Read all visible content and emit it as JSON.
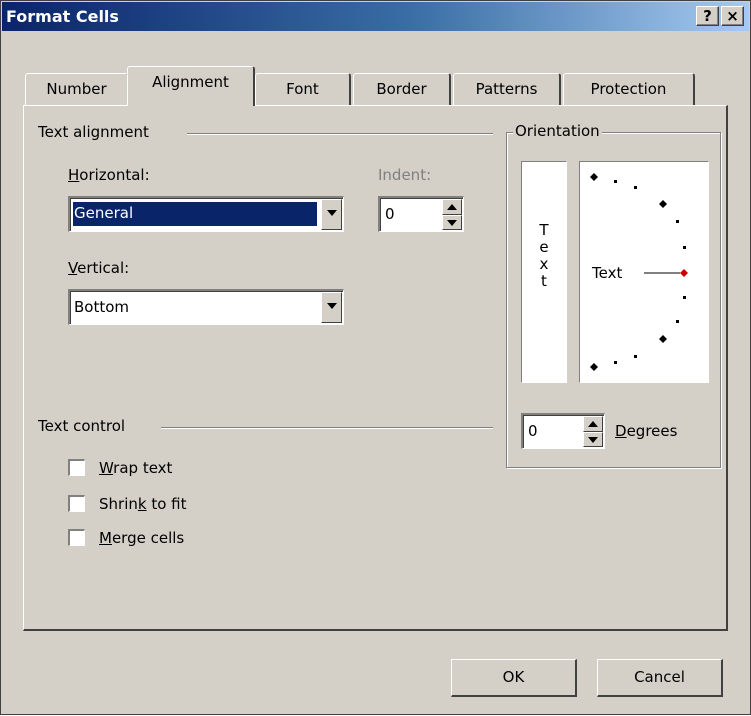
{
  "window": {
    "title": "Format Cells",
    "help_button": "?",
    "close_button": "×"
  },
  "tabs": [
    "Number",
    "Alignment",
    "Font",
    "Border",
    "Patterns",
    "Protection"
  ],
  "active_tab": "Alignment",
  "text_alignment": {
    "section_label": "Text alignment",
    "horizontal": {
      "label_u": "H",
      "label_rest": "orizontal:",
      "value": "General"
    },
    "indent": {
      "label": "Indent:",
      "value": "0"
    },
    "vertical": {
      "label_u": "V",
      "label_rest": "ertical:",
      "value": "Bottom"
    }
  },
  "text_control": {
    "section_label": "Text control",
    "wrap": {
      "u": "W",
      "rest": "rap text",
      "checked": false
    },
    "shrink": {
      "pre": "Shrin",
      "u": "k",
      "rest": " to fit",
      "checked": false
    },
    "merge": {
      "u": "M",
      "rest": "erge cells",
      "checked": false
    }
  },
  "orientation": {
    "section_label": "Orientation",
    "vertical_text": [
      "T",
      "e",
      "x",
      "t"
    ],
    "dial_text": "Text",
    "degrees_value": "0",
    "degrees_u": "D",
    "degrees_rest": "egrees",
    "accent_color": "#cc0000"
  },
  "buttons": {
    "ok": "OK",
    "cancel": "Cancel"
  }
}
